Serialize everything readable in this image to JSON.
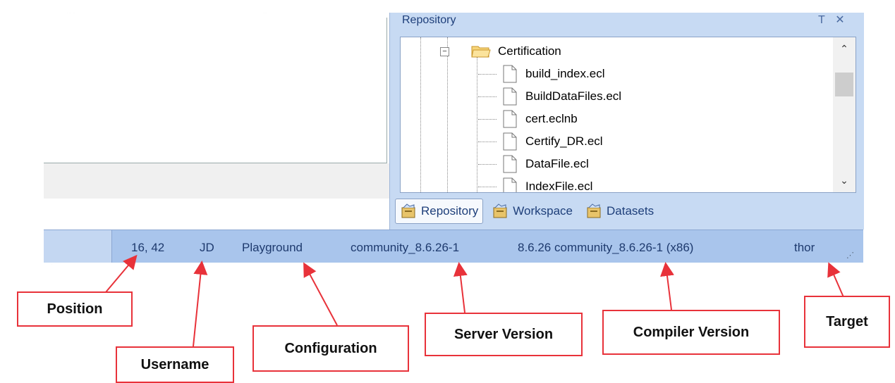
{
  "dock": {
    "title": "Repository",
    "pin_glyph": "Т",
    "close_glyph": "✕"
  },
  "tree": {
    "folder": "Certification",
    "expander_glyph": "−",
    "files": [
      "build_index.ecl",
      "BuildDataFiles.ecl",
      "cert.eclnb",
      "Certify_DR.ecl",
      "DataFile.ecl",
      "IndexFile.ecl"
    ]
  },
  "scroll": {
    "up": "⌃",
    "down": "⌄"
  },
  "tabs": [
    {
      "label": "Repository",
      "active": true,
      "icon": "repository-icon"
    },
    {
      "label": "Workspace",
      "active": false,
      "icon": "workspace-icon"
    },
    {
      "label": "Datasets",
      "active": false,
      "icon": "datasets-icon"
    }
  ],
  "status": {
    "position": "16, 42",
    "username": "JD",
    "configuration": "Playground",
    "server_version": "community_8.6.26-1",
    "compiler_version": "8.6.26 community_8.6.26-1 (x86)",
    "target": "thor"
  },
  "callouts": {
    "position": "Position",
    "username": "Username",
    "configuration": "Configuration",
    "server_version": "Server Version",
    "compiler_version": "Compiler Version",
    "target": "Target"
  },
  "colors": {
    "statusbar": "#a9c5ec",
    "dock": "#c7daf3",
    "callout_border": "#e8323a",
    "arrow": "#e8323a"
  }
}
